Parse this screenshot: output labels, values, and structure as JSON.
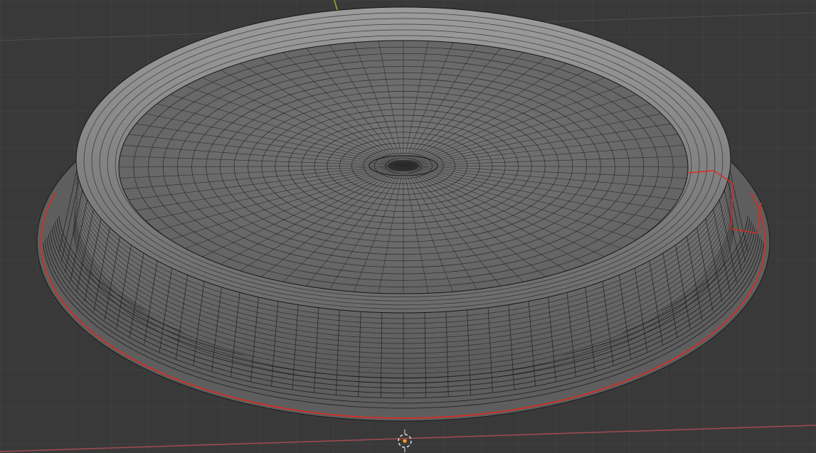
{
  "app": {
    "name": "3D Viewport",
    "mode": "edit-mode-wireframe"
  },
  "scene": {
    "object": "dish-mesh",
    "display": "wireframe",
    "selection": "boundary-edge-loop"
  },
  "colors": {
    "viewport_bg": "#393939",
    "grid": "#4a4a4a",
    "mesh_face": "#6f6f6f",
    "mesh_face_light": "#8a8a8a",
    "wire": "#1a1a1a",
    "selected_edge": "#e0291e",
    "x_axis": "#a34a55",
    "y_axis": "#8fb33a",
    "origin": "#f0a030"
  },
  "icons": {
    "origin_marker": "origin-icon",
    "cursor_3d": "3d-cursor-icon"
  }
}
